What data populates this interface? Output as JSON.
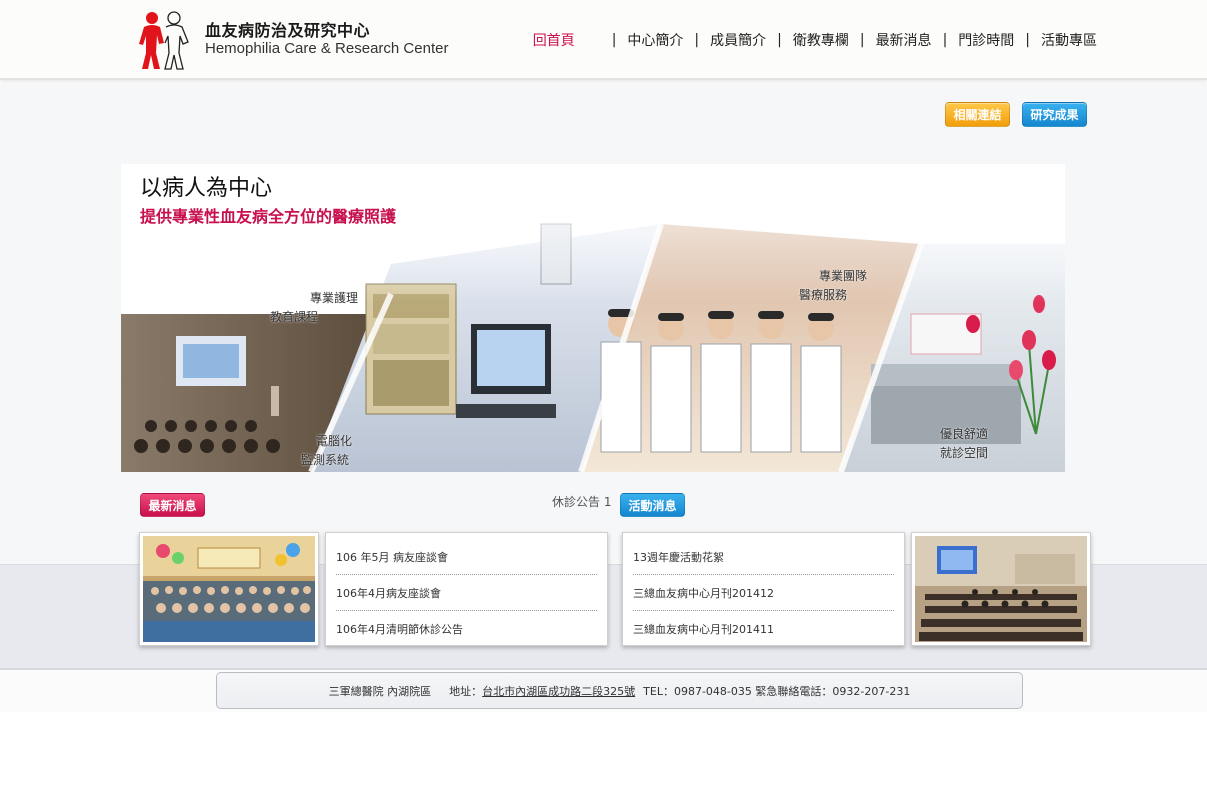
{
  "header": {
    "logo_cn": "血友病防治及研究中心",
    "logo_en": "Hemophilia Care & Research Center",
    "nav": [
      {
        "label": "回首頁",
        "active": true
      },
      {
        "label": "中心簡介"
      },
      {
        "label": "成員簡介"
      },
      {
        "label": "衛教專欄"
      },
      {
        "label": "最新消息"
      },
      {
        "label": "門診時間"
      },
      {
        "label": "活動專區"
      }
    ],
    "nav_separator": "|"
  },
  "quick_buttons": {
    "links": "相關連結",
    "research": "研究成果"
  },
  "banner": {
    "title": "以病人為中心",
    "subtitle": "提供專業性血友病全方位的醫療照護",
    "labels": {
      "nursing": "專業護理",
      "education": "教育課程",
      "computer_1": "電腦化",
      "computer_2": "監測系統",
      "team": "專業團隊",
      "medical": "醫療服務",
      "space_1": "優良舒適",
      "space_2": "就診空間"
    }
  },
  "news": {
    "tag": "最新消息",
    "closure_notice": "休診公告 1",
    "items": [
      "106 年5月 病友座談會",
      "106年4月病友座談會",
      "106年4月清明節休診公告"
    ]
  },
  "activities": {
    "tag": "活動消息",
    "items": [
      "13週年慶活動花絮",
      "三總血友病中心月刊201412",
      "三總血友病中心月刊201411"
    ]
  },
  "footer": {
    "hospital": "三軍總醫院 內湖院區",
    "address_label": "地址：",
    "address": "台北市內湖區成功路二段325號",
    "tel": "TEL：0987-048-035 緊急聯絡電話：0932-207-231"
  },
  "colors": {
    "brand_red": "#c8104d",
    "orange": "#f29d0b",
    "blue": "#1586cf"
  }
}
